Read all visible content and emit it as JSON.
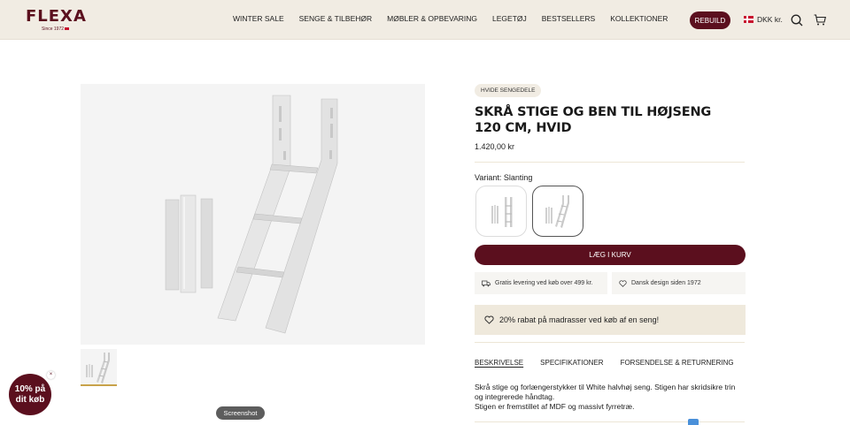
{
  "header": {
    "logo": "FLEXA",
    "logo_since": "Since 1972",
    "nav": [
      "WINTER SALE",
      "SENGE & TILBEHØR",
      "MØBLER & OPBEVARING",
      "LEGETØJ",
      "BESTSELLERS",
      "KOLLEKTIONER"
    ],
    "rebuild_label": "REBUILD",
    "currency": "DKK kr.",
    "brand_color": "#5b0f1e"
  },
  "product": {
    "badge": "HVIDE SENGEDELE",
    "title": "SKRÅ STIGE OG BEN TIL HØJSENG 120 CM, HVID",
    "price": "1.420,00 kr",
    "variant_label": "Variant: Slanting",
    "add_to_cart": "LÆG I KURV",
    "features": [
      "Gratis levering ved køb over 499 kr.",
      "Dansk design siden 1972"
    ],
    "promo": "20% rabat på madrasser ved køb af en seng!",
    "tabs": [
      "BESKRIVELSE",
      "SPECIFIKATIONER",
      "FORSENDELSE & RETURNERING"
    ],
    "description": [
      "Skrå stige og forlængerstykker til White halvhøj seng. Stigen har skridsikre trin og integrerede håndtag.",
      "Stigen er fremstillet af MDF og massivt fyrretræ."
    ]
  },
  "overlays": {
    "discount": "10% på dit køb",
    "discount_close": "×",
    "screenshot": "Screenshot"
  }
}
